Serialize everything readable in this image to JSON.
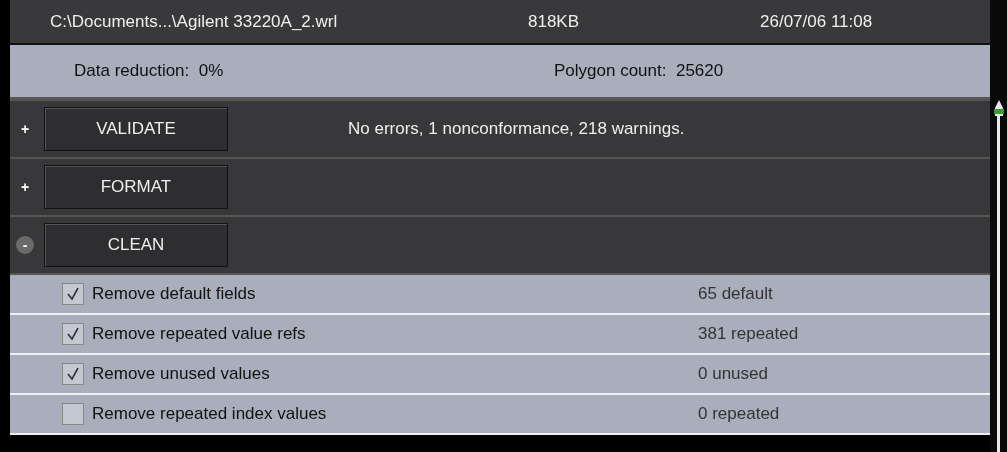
{
  "file": {
    "path": "C:\\Documents...\\Agilent 33220A_2.wrl",
    "size": "818KB",
    "date": "26/07/06 11:08"
  },
  "info": {
    "reduction_label": "Data reduction:",
    "reduction": "0%",
    "polygon_label": "Polygon count:",
    "polygons": "25620"
  },
  "sections": [
    {
      "toggle": "+",
      "expanded": false,
      "label": "VALIDATE",
      "summary": "No errors, 1 nonconformance, 218 warnings."
    },
    {
      "toggle": "+",
      "expanded": false,
      "label": "FORMAT"
    },
    {
      "toggle": "-",
      "expanded": true,
      "label": "CLEAN"
    }
  ],
  "options": [
    {
      "label": "Remove default fields",
      "checked": true,
      "count": "65 default"
    },
    {
      "label": "Remove repeated value refs",
      "checked": true,
      "count": "381 repeated"
    },
    {
      "label": "Remove unused values",
      "checked": true,
      "count": "0 unused"
    },
    {
      "label": "Remove repeated index values",
      "checked": false,
      "count": "0 repeated"
    }
  ]
}
